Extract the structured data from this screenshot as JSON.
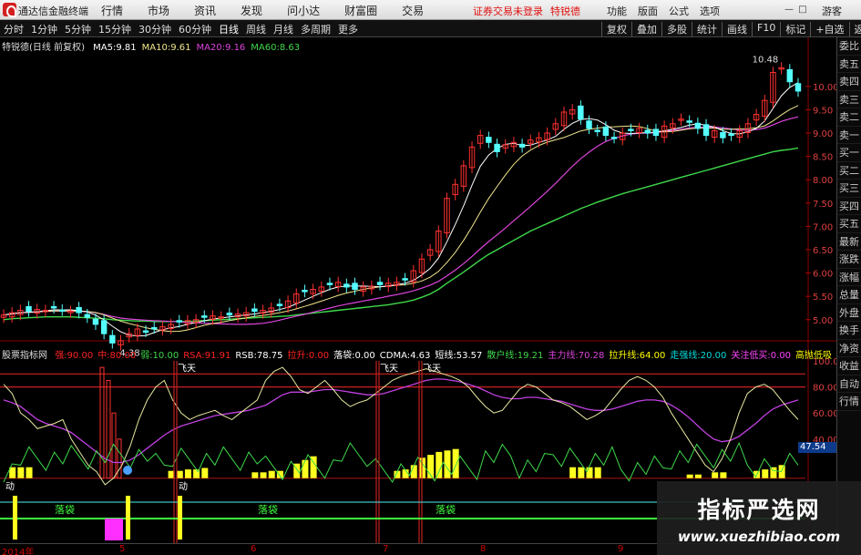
{
  "app": {
    "title": "通达信金融终端",
    "menu": [
      "行情",
      "市场",
      "资讯",
      "发现",
      "问小达",
      "财富圈",
      "交易"
    ],
    "notice": "证券交易未登录",
    "stock_short": "特锐德",
    "right_menu": [
      "功能",
      "版面",
      "公式",
      "选项"
    ],
    "guest": "游客"
  },
  "toolbar": {
    "periods": [
      "分时",
      "1分钟",
      "5分钟",
      "15分钟",
      "30分钟",
      "60分钟",
      "日线",
      "周线",
      "月线",
      "多周期",
      "更多"
    ],
    "active": "日线",
    "right": [
      "复权",
      "叠加",
      "多股",
      "统计",
      "画线",
      "F10",
      "标记",
      "+自选",
      "返回"
    ]
  },
  "stock": {
    "name": "特锐德(日线 前复权)"
  },
  "ma": [
    {
      "label": "MA5:",
      "value": "9.81",
      "color": "#ffffff"
    },
    {
      "label": "MA10:",
      "value": "9.61",
      "color": "#f0e68c"
    },
    {
      "label": "MA20:",
      "value": "9.16",
      "color": "#dd44dd"
    },
    {
      "label": "MA60:",
      "value": "8.63",
      "color": "#3ed84a"
    }
  ],
  "price_axis": [
    "10.00",
    "9.50",
    "9.00",
    "8.50",
    "8.00",
    "7.50",
    "7.00",
    "6.50",
    "6.00",
    "5.50",
    "5.00"
  ],
  "annotations": {
    "high": "10.48",
    "low": "4.38"
  },
  "indicator": {
    "name": "股票指标网",
    "values": [
      {
        "label": "强:",
        "value": "90.00",
        "color": "#ff2222"
      },
      {
        "label": "中:",
        "value": "80.00",
        "color": "#ff2222"
      },
      {
        "label": "弱:",
        "value": "10.00",
        "color": "#3ed84a"
      },
      {
        "label": "RSA:",
        "value": "91.91",
        "color": "#ff2222"
      },
      {
        "label": "RSB:",
        "value": "78.75",
        "color": "#ffffff"
      },
      {
        "label": "拉升:",
        "value": "0.00",
        "color": "#ff2222"
      },
      {
        "label": "落袋:",
        "value": "0.00",
        "color": "#ffffff"
      },
      {
        "label": "CDMA:",
        "value": "4.63",
        "color": "#ffffff"
      },
      {
        "label": "短线:",
        "value": "53.57",
        "color": "#ffffff"
      },
      {
        "label": "散户线:",
        "value": "19.21",
        "color": "#3ed84a"
      },
      {
        "label": "主力线:",
        "value": "70.28",
        "color": "#dd44dd"
      },
      {
        "label": "拉升线:",
        "value": "64.00",
        "color": "#ffff00"
      },
      {
        "label": "走强线:",
        "value": "20.00",
        "color": "#00dddd"
      },
      {
        "label": "关注低买:",
        "value": "0.00",
        "color": "#ff44ff"
      },
      {
        "label": "高抛低吸",
        "value": "",
        "color": "#ffff00"
      }
    ],
    "axis": [
      "100.00",
      "80.00",
      "60.00",
      "40.00"
    ],
    "current": "47.54",
    "labels": {
      "fly": "飞天",
      "drop": "落袋",
      "move": "动",
      "pull": "拉升"
    }
  },
  "dates": [
    "2014年",
    "5",
    "6",
    "7",
    "8",
    "9"
  ],
  "sidebar": [
    "委比",
    "卖五",
    "卖四",
    "卖三",
    "卖二",
    "卖一",
    "买一",
    "买二",
    "买三",
    "买四",
    "买五",
    "最新",
    "涨跌",
    "涨幅",
    "总量",
    "外盘",
    "换手",
    "净资",
    "收益",
    "自动",
    "行情"
  ],
  "watermark": {
    "name": "指标严选网",
    "url": "www.xuezhibiao.com"
  },
  "chart_data": {
    "type": "candlestick",
    "ylim": [
      4.8,
      10.7
    ],
    "series": [
      {
        "name": "MA5",
        "color": "#ffffff"
      },
      {
        "name": "MA10",
        "color": "#f0e68c"
      },
      {
        "name": "MA20",
        "color": "#dd44dd"
      },
      {
        "name": "MA60",
        "color": "#3ed84a"
      }
    ],
    "close": [
      5.1,
      5.15,
      5.2,
      5.18,
      5.22,
      5.2,
      5.25,
      5.2,
      5.18,
      5.15,
      5.05,
      4.9,
      4.7,
      4.5,
      4.55,
      4.7,
      4.8,
      4.75,
      4.82,
      4.85,
      4.9,
      4.95,
      4.98,
      5.0,
      5.05,
      5.08,
      5.06,
      5.1,
      5.12,
      5.15,
      5.18,
      5.2,
      5.25,
      5.3,
      5.4,
      5.55,
      5.6,
      5.65,
      5.7,
      5.75,
      5.8,
      5.7,
      5.65,
      5.7,
      5.72,
      5.75,
      5.78,
      5.8,
      5.85,
      6.05,
      6.3,
      6.5,
      6.9,
      7.6,
      7.9,
      8.3,
      8.7,
      8.95,
      8.8,
      8.6,
      8.75,
      8.8,
      8.7,
      8.85,
      8.9,
      9.0,
      9.2,
      9.45,
      9.5,
      9.3,
      9.1,
      9.05,
      8.95,
      8.9,
      9.0,
      9.05,
      9.1,
      9.0,
      8.95,
      9.15,
      9.2,
      9.3,
      9.25,
      9.1,
      8.95,
      9.05,
      8.9,
      8.95,
      9.05,
      9.2,
      9.4,
      9.7,
      10.3,
      10.4,
      10.1,
      9.9
    ],
    "ma60": [
      5.0,
      5.02,
      5.03,
      5.04,
      5.05,
      5.06,
      5.06,
      5.06,
      5.06,
      5.05,
      5.04,
      5.03,
      5.02,
      5.0,
      4.99,
      4.98,
      4.97,
      4.97,
      4.96,
      4.96,
      4.96,
      4.96,
      4.96,
      4.97,
      4.98,
      4.99,
      5.0,
      5.01,
      5.02,
      5.03,
      5.04,
      5.05,
      5.06,
      5.07,
      5.08,
      5.1,
      5.12,
      5.14,
      5.16,
      5.18,
      5.2,
      5.22,
      5.24,
      5.26,
      5.28,
      5.3,
      5.32,
      5.35,
      5.38,
      5.42,
      5.48,
      5.55,
      5.65,
      5.78,
      5.9,
      6.02,
      6.15,
      6.28,
      6.4,
      6.5,
      6.6,
      6.7,
      6.8,
      6.9,
      6.98,
      7.06,
      7.14,
      7.22,
      7.3,
      7.38,
      7.45,
      7.52,
      7.58,
      7.64,
      7.7,
      7.75,
      7.8,
      7.85,
      7.9,
      7.95,
      8.0,
      8.05,
      8.1,
      8.15,
      8.2,
      8.25,
      8.3,
      8.35,
      8.4,
      8.45,
      8.5,
      8.55,
      8.6,
      8.63,
      8.65,
      8.68
    ],
    "ind_short": [
      82,
      75,
      60,
      55,
      48,
      50,
      52,
      55,
      40,
      30,
      20,
      15,
      5,
      10,
      20,
      35,
      55,
      70,
      80,
      85,
      70,
      60,
      55,
      58,
      60,
      62,
      58,
      55,
      60,
      65,
      70,
      85,
      92,
      95,
      88,
      78,
      75,
      80,
      85,
      78,
      70,
      65,
      68,
      70,
      75,
      80,
      85,
      88,
      90,
      92,
      94,
      92,
      90,
      88,
      85,
      80,
      72,
      65,
      60,
      62,
      70,
      78,
      82,
      80,
      75,
      70,
      68,
      65,
      60,
      55,
      58,
      62,
      70,
      78,
      85,
      88,
      85,
      80,
      72,
      60,
      50,
      40,
      30,
      20,
      15,
      25,
      40,
      60,
      75,
      80,
      82,
      78,
      70,
      62,
      55
    ],
    "ind_main": [
      70,
      68,
      65,
      60,
      55,
      52,
      50,
      48,
      45,
      40,
      35,
      30,
      25,
      22,
      22,
      24,
      28,
      33,
      38,
      43,
      47,
      50,
      52,
      54,
      56,
      58,
      59,
      60,
      61,
      62,
      64,
      66,
      70,
      74,
      76,
      76,
      76,
      77,
      78,
      78,
      77,
      76,
      75,
      74,
      74,
      75,
      77,
      79,
      81,
      83,
      85,
      86,
      86,
      85,
      84,
      82,
      80,
      77,
      74,
      72,
      71,
      71,
      72,
      72,
      71,
      70,
      69,
      67,
      65,
      63,
      62,
      62,
      63,
      65,
      67,
      69,
      70,
      70,
      69,
      66,
      62,
      57,
      51,
      45,
      40,
      38,
      39,
      42,
      47,
      52,
      58,
      63,
      66,
      68,
      70
    ],
    "bars": [
      0,
      15,
      15,
      15,
      0,
      0,
      0,
      0,
      0,
      0,
      0,
      0,
      0,
      0,
      0,
      0,
      0,
      0,
      0,
      0,
      10,
      10,
      12,
      12,
      14,
      0,
      0,
      0,
      0,
      0,
      8,
      8,
      10,
      10,
      0,
      20,
      25,
      30,
      0,
      0,
      0,
      0,
      0,
      0,
      0,
      0,
      0,
      10,
      12,
      18,
      28,
      32,
      36,
      38,
      40,
      0,
      0,
      0,
      0,
      0,
      0,
      0,
      0,
      0,
      0,
      0,
      0,
      0,
      15,
      15,
      15,
      15,
      0,
      0,
      0,
      0,
      0,
      0,
      0,
      0,
      0,
      0,
      5,
      5,
      0,
      8,
      8,
      0,
      0,
      0,
      10,
      12,
      15,
      18,
      0,
      0
    ]
  }
}
